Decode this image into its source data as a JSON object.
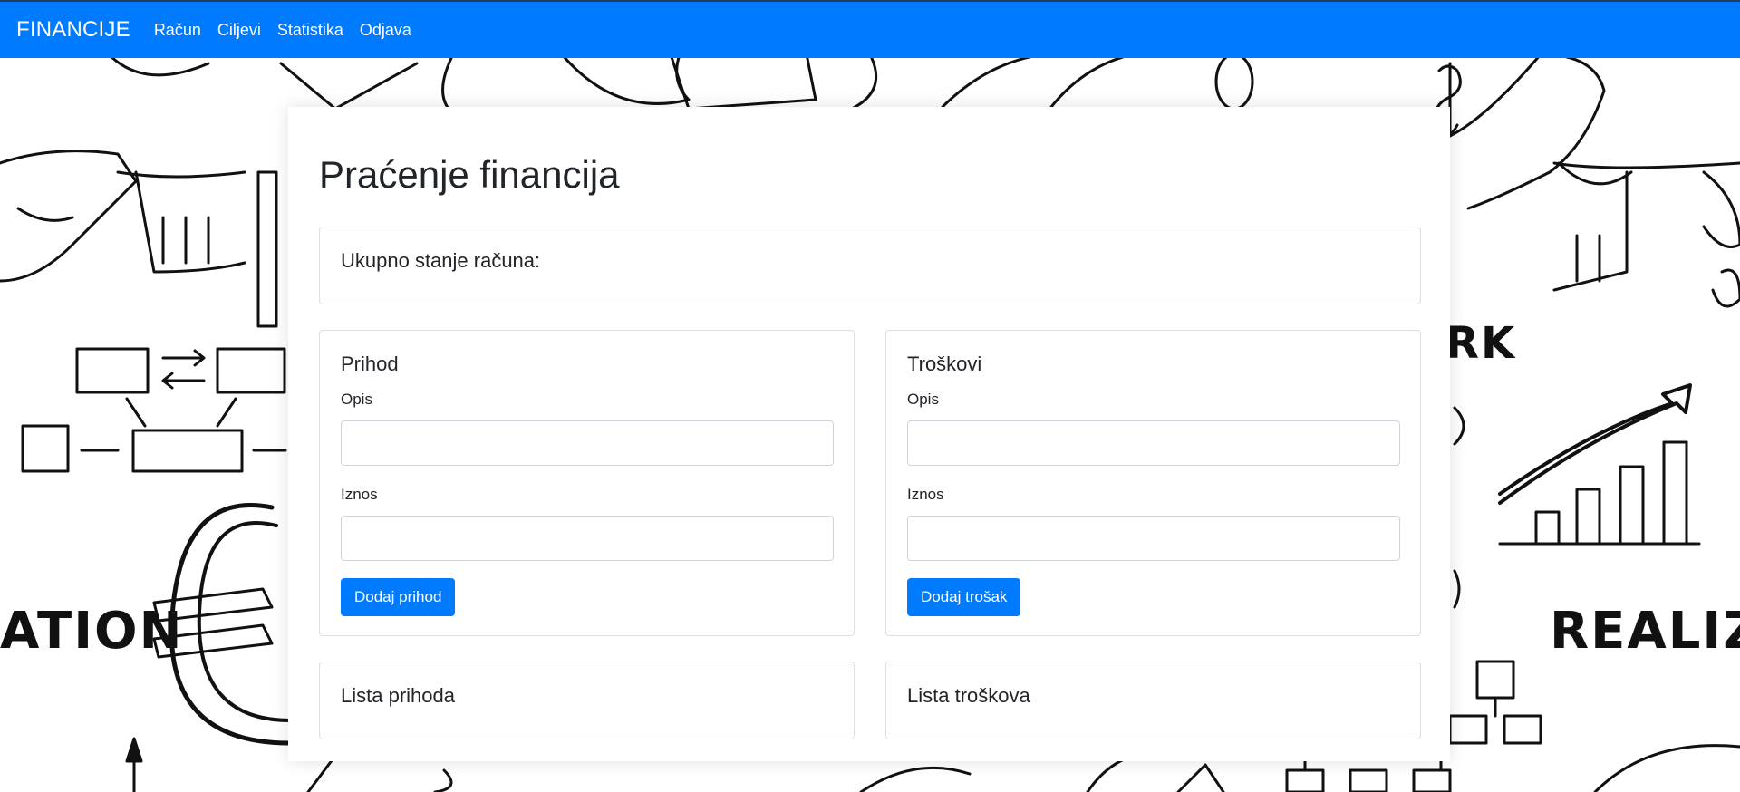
{
  "navbar": {
    "brand": "FINANCIJE",
    "links": [
      "Račun",
      "Ciljevi",
      "Statistika",
      "Odjava"
    ],
    "color": "#007bff"
  },
  "page": {
    "title": "Praćenje financija"
  },
  "balance": {
    "label": "Ukupno stanje računa:"
  },
  "income": {
    "title": "Prihod",
    "description_label": "Opis",
    "description_value": "",
    "amount_label": "Iznos",
    "amount_value": "",
    "button": "Dodaj prihod"
  },
  "expenses": {
    "title": "Troškovi",
    "description_label": "Opis",
    "description_value": "",
    "amount_label": "Iznos",
    "amount_value": "",
    "button": "Dodaj trošak"
  },
  "lists": {
    "income_title": "Lista prihoda",
    "expenses_title": "Lista troškova"
  },
  "background_text": {
    "left": "ATION",
    "right": "REALIZA",
    "right_top": "RK"
  }
}
